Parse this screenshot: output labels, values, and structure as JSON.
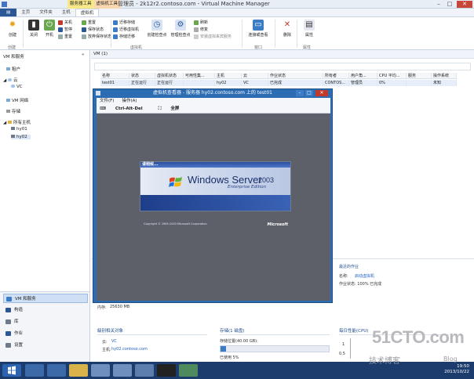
{
  "titlebar": {
    "ctx_tab_1": "服务器工具",
    "ctx_tab_2": "虚拟机工具",
    "title": "管理员 - 2k12r2.contoso.com - Virtual Machine Manager"
  },
  "ribbon_tabs": [
    "主页",
    "文件夹",
    "主机",
    "虚拟机"
  ],
  "ribbon": {
    "create": "创建",
    "shutdown": "关闭",
    "power_on": "开机",
    "small_col1": [
      "关机",
      "暂停",
      "重置"
    ],
    "small_col2": [
      "重置",
      "保存状态",
      "放弃保存状态"
    ],
    "small_col3": [
      "迁移存储",
      "迁移虚拟机",
      "存储迁移"
    ],
    "checkpoint_create": "创建检查点",
    "checkpoint_manage": "管理检查点",
    "small_col4": [
      "刷新",
      "修复",
      "安装虚拟来宾服务"
    ],
    "connect": "连接或查看",
    "delete": "删除",
    "properties": "属性",
    "groups": [
      "创建",
      "虚拟机",
      "窗口",
      "属性"
    ]
  },
  "leftnav": {
    "title": "VM 和服务",
    "items": [
      "租户",
      "云",
      "VC",
      "VM 网络",
      "存储",
      "所有主机",
      "hy01",
      "hy02"
    ]
  },
  "wunderbar": [
    "VM 和服务",
    "构造",
    "库",
    "作业",
    "设置"
  ],
  "main": {
    "header": "VM (1)",
    "columns": [
      "名称",
      "状态",
      "虚拟机状态",
      "可用性集...",
      "主机",
      "云",
      "作业状态",
      "所有者",
      "用户角...",
      "CPU 平均...",
      "服务",
      "操作系统"
    ],
    "row": [
      "test01",
      "正在运行",
      "正在运行",
      "",
      "hy02",
      "VC",
      "已完成",
      "CONTOS...",
      "管理员",
      "0%",
      "",
      "未知"
    ]
  },
  "details": {
    "memory_label": "内存:",
    "memory_value": "25630 MB",
    "related_title": "級别相关对象",
    "cloud_label": "云:",
    "cloud_value": "VC",
    "host_label": "主机:",
    "host_value": "hy02.contoso.com",
    "storage_title": "存储(1 磁盘)",
    "storage_disk": "存储位置(40.00 GB):",
    "storage_used": "已使用 5%",
    "storage_pct": 0.05,
    "recent_title": "最近的作业",
    "recent_name_label": "名称:",
    "recent_name_value": "启动虚拟机",
    "recent_status": "作业状态: 100% 已完成",
    "perf_title": "每日性能(CPU)",
    "perf_y1": "1",
    "perf_y2": "0.5"
  },
  "viewer": {
    "title": "虚拟机查看器 - 服务器 hy02.contoso.com 上的 test01",
    "menu": [
      "文件(F)",
      "操作(A)"
    ],
    "toolbar": [
      "Ctrl-Alt-Del",
      "全屏"
    ],
    "splash_title": "请稍候...",
    "product": "Windows Server",
    "year": "2003",
    "edition": "Enterprise Edition",
    "copyright": "Copyright © 1985-2003  Microsoft Corporation",
    "brand": "Microsoft"
  },
  "taskbar": {
    "time": "19:50",
    "date": "2013/10/22"
  },
  "watermark": {
    "site": "51CTO.com",
    "sub": "技术博客",
    "blog": "Blog"
  }
}
